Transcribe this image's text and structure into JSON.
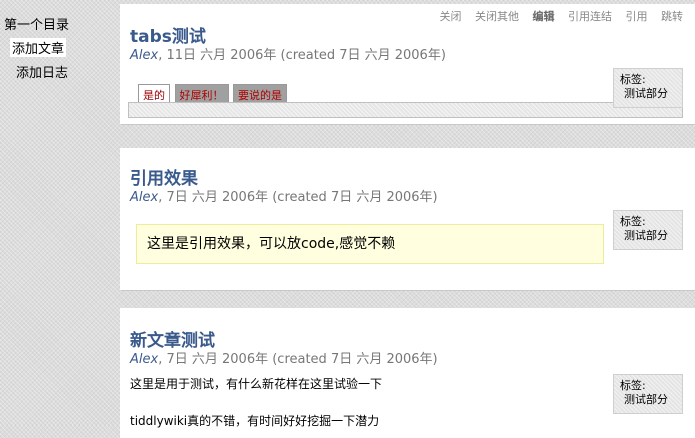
{
  "sidebar": {
    "items": [
      "第一个目录",
      "添加文章",
      "添加日志"
    ]
  },
  "toolbar": [
    "关闭",
    "关闭其他",
    "编辑",
    "引用连结",
    "引用",
    "跳转"
  ],
  "tiddlers": [
    {
      "title": "tabs测试",
      "author": "Alex",
      "date": ", 11日 六月 2006年 (created 7日 六月 2006年)",
      "tabs": [
        "是的",
        "好犀利！",
        "要说的是"
      ],
      "tag_label": "标签:",
      "tag": "测试部分"
    },
    {
      "title": "引用效果",
      "author": "Alex",
      "date": ", 7日 六月 2006年 (created 7日 六月 2006年)",
      "quote": "这里是引用效果，可以放code,感觉不赖",
      "tag_label": "标签:",
      "tag": "测试部分"
    },
    {
      "title": "新文章测试",
      "author": "Alex",
      "date": ", 7日 六月 2006年 (created 7日 六月 2006年)",
      "lines": [
        "这里是用于测试，有什么新花样在这里试验一下",
        "tiddlywiki真的不错，有时间好好挖掘一下潜力"
      ],
      "tag_label": "标签:",
      "tag": "测试部分"
    }
  ]
}
